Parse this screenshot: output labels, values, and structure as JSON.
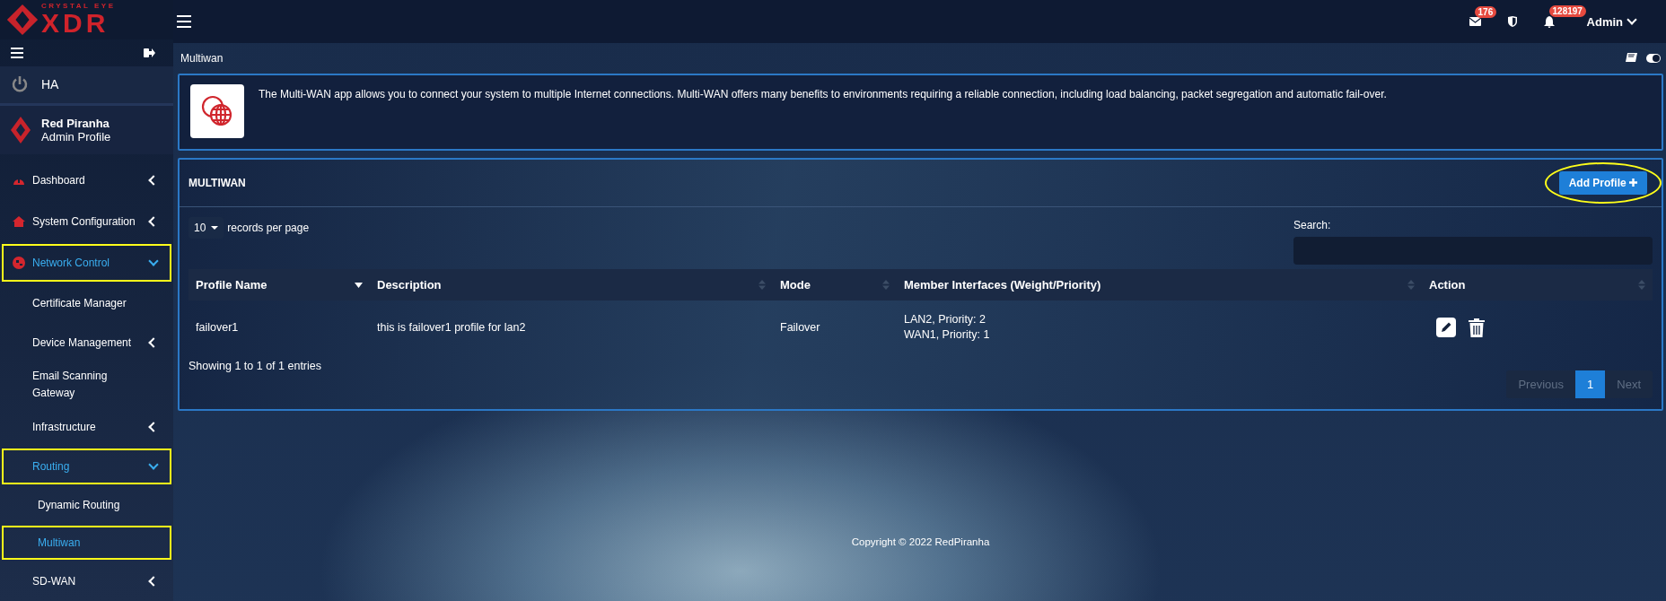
{
  "logo": {
    "tagline": "CRYSTAL EYE",
    "wordmark": "XDR"
  },
  "topbar": {
    "mail_badge": "176",
    "alert_badge": "128197",
    "user": "Admin"
  },
  "sidebar": {
    "ha_label": "HA",
    "profile": {
      "name": "Red Piranha",
      "role": "Admin Profile"
    },
    "items": [
      {
        "label": "Dashboard",
        "kind": "group",
        "expanded": false,
        "selected": false,
        "highlighted": false
      },
      {
        "label": "System Configuration",
        "kind": "group",
        "expanded": false,
        "selected": false,
        "highlighted": false
      },
      {
        "label": "Network Control",
        "kind": "group",
        "expanded": true,
        "selected": true,
        "highlighted": true,
        "children": [
          {
            "label": "Certificate Manager",
            "kind": "link",
            "selected": false,
            "highlighted": false
          },
          {
            "label": "Device Management",
            "kind": "group",
            "expanded": false,
            "selected": false,
            "highlighted": false
          },
          {
            "label": "Email Scanning Gateway",
            "kind": "link",
            "selected": false,
            "highlighted": false
          },
          {
            "label": "Infrastructure",
            "kind": "group",
            "expanded": false,
            "selected": false,
            "highlighted": false
          },
          {
            "label": "Routing",
            "kind": "group",
            "expanded": true,
            "selected": true,
            "highlighted": true,
            "children": [
              {
                "label": "Dynamic Routing",
                "selected": false,
                "highlighted": false
              },
              {
                "label": "Multiwan",
                "selected": true,
                "highlighted": true
              }
            ]
          },
          {
            "label": "SD-WAN",
            "kind": "group",
            "expanded": false,
            "selected": false,
            "highlighted": false
          }
        ]
      }
    ]
  },
  "page": {
    "breadcrumb": "Multiwan",
    "toggle_on": true,
    "intro": "The Multi-WAN app allows you to connect your system to multiple Internet connections. Multi-WAN offers many benefits to environments requiring a reliable connection, including load balancing, packet segregation and automatic fail-over."
  },
  "panel": {
    "title": "MULTIWAN",
    "add_button": {
      "label": "Add Profile",
      "highlighted": true
    },
    "page_size": "10",
    "page_size_label": "records per page",
    "search_label": "Search:",
    "columns": [
      {
        "label": "Profile Name",
        "sorted": true
      },
      {
        "label": "Description",
        "sorted": false
      },
      {
        "label": "Mode",
        "sorted": false
      },
      {
        "label": "Member Interfaces (Weight/Priority)",
        "sorted": false
      },
      {
        "label": "Action",
        "sorted": false
      }
    ],
    "rows": [
      {
        "profile_name": "failover1",
        "description": "this is failover1 profile for lan2",
        "mode": "Failover",
        "members": [
          "LAN2, Priority: 2",
          "WAN1, Priority: 1"
        ]
      }
    ],
    "info": "Showing 1 to 1 of 1 entries",
    "pagination": [
      {
        "label": "Previous",
        "selected": false
      },
      {
        "label": "1",
        "selected": true
      },
      {
        "label": "Next",
        "selected": false
      }
    ]
  },
  "footer": "Copyright © 2022 RedPiranha"
}
